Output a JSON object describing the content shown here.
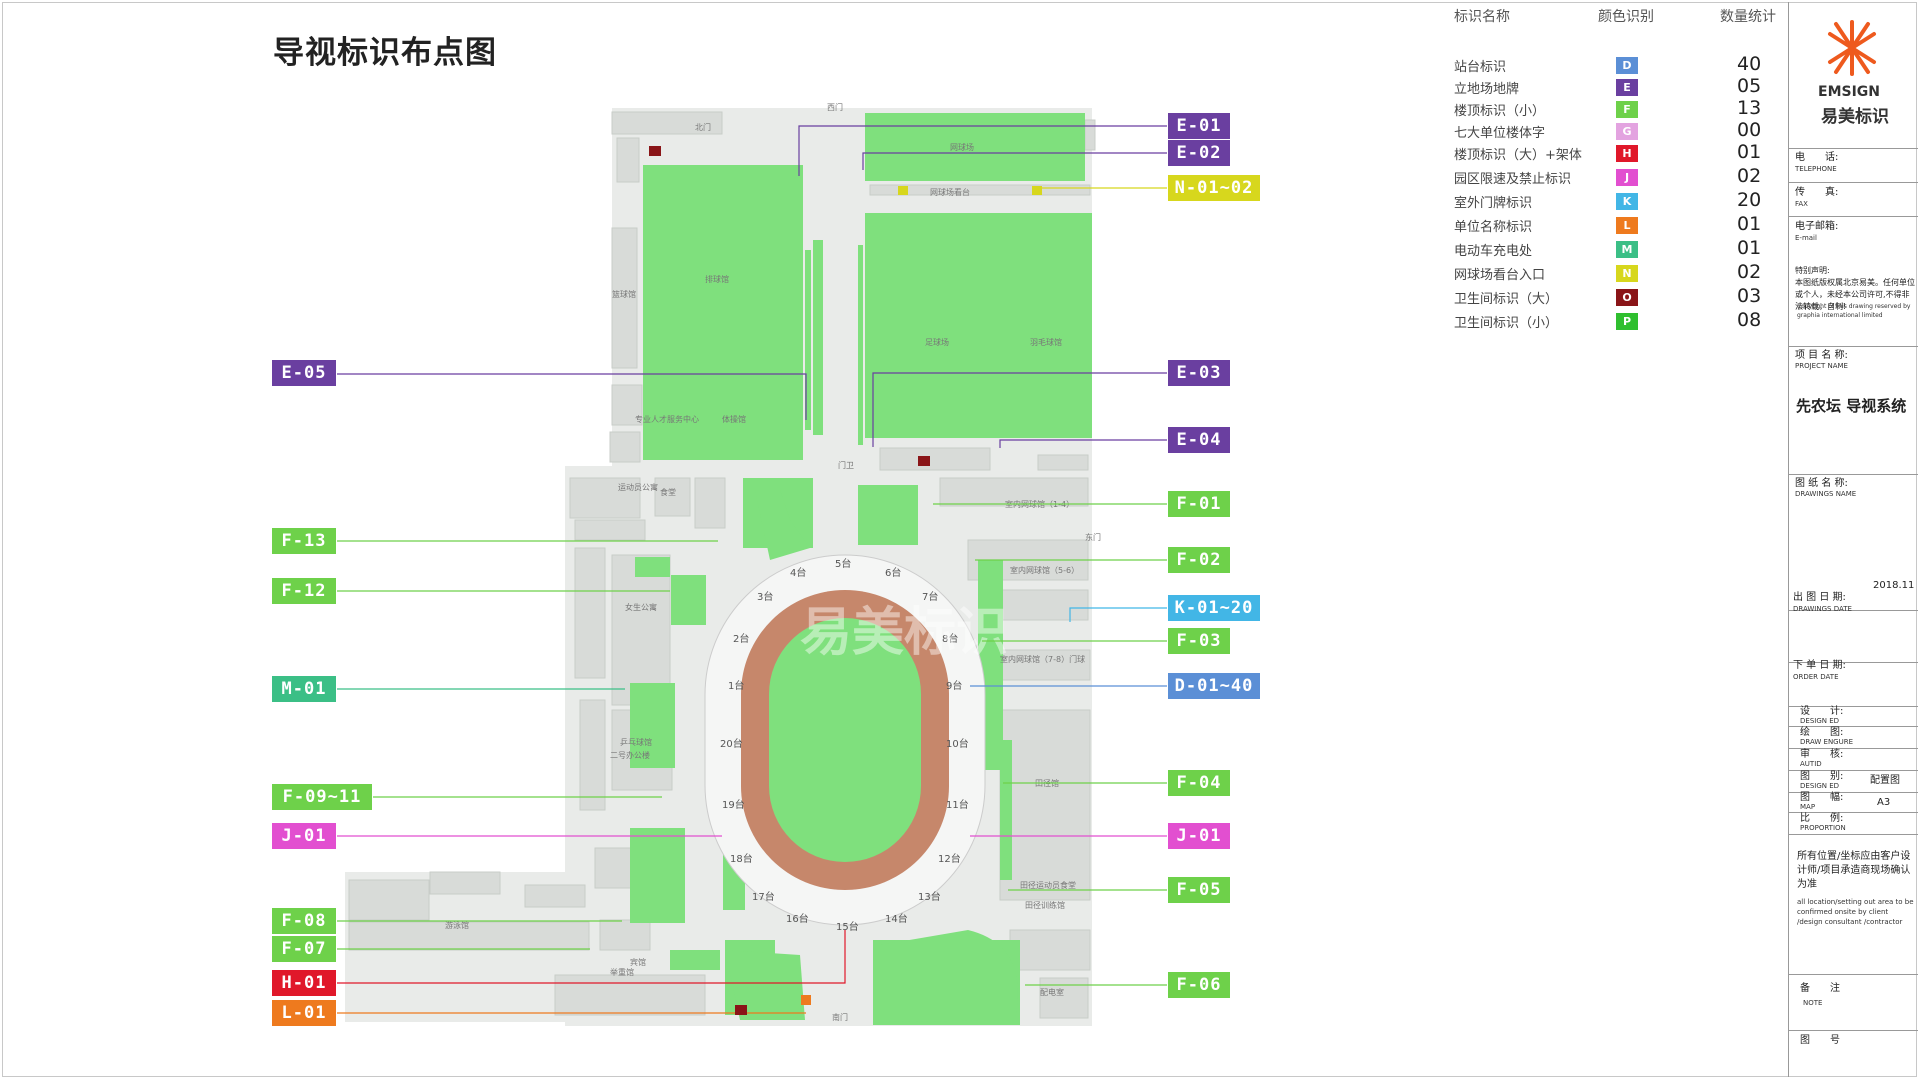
{
  "title": "导视标识布点图",
  "legend": {
    "headers": {
      "name": "标识名称",
      "color": "颜色识别",
      "count": "数量统计"
    },
    "items": [
      {
        "name": "站台标识",
        "letter": "D",
        "color": "#5b8fd6",
        "count": "40"
      },
      {
        "name": "立地场地牌",
        "letter": "E",
        "color": "#6a3fa0",
        "count": "05"
      },
      {
        "name": "楼顶标识（小）",
        "letter": "F",
        "color": "#6ed14a",
        "count": "13"
      },
      {
        "name": "七大单位楼体字",
        "letter": "G",
        "color": "#e3a3e0",
        "count": "00"
      },
      {
        "name": "楼顶标识（大）+架体",
        "letter": "H",
        "color": "#e0182a",
        "count": "01"
      },
      {
        "name": "园区限速及禁止标识",
        "letter": "J",
        "color": "#e24fd0",
        "count": "02"
      },
      {
        "name": "室外门牌标识",
        "letter": "K",
        "color": "#42b6e6",
        "count": "20"
      },
      {
        "name": "单位名称标识",
        "letter": "L",
        "color": "#ee7a1e",
        "count": "01"
      },
      {
        "name": "电动车充电处",
        "letter": "M",
        "color": "#3bbf86",
        "count": "01"
      },
      {
        "name": "网球场看台入口",
        "letter": "N",
        "color": "#d7d71d",
        "count": "02"
      },
      {
        "name": "卫生间标识（大）",
        "letter": "O",
        "color": "#8a1518",
        "count": "03"
      },
      {
        "name": "卫生间标识（小）",
        "letter": "P",
        "color": "#2fbf2f",
        "count": "08"
      }
    ]
  },
  "tags_left": [
    {
      "label": "E-05",
      "color": "#6a3fa0"
    },
    {
      "label": "F-13",
      "color": "#6ed14a"
    },
    {
      "label": "F-12",
      "color": "#6ed14a"
    },
    {
      "label": "M-01",
      "color": "#3bbf86"
    },
    {
      "label": "F-09~11",
      "color": "#6ed14a"
    },
    {
      "label": "J-01",
      "color": "#e24fd0"
    },
    {
      "label": "F-08",
      "color": "#6ed14a"
    },
    {
      "label": "F-07",
      "color": "#6ed14a"
    },
    {
      "label": "H-01",
      "color": "#e0182a"
    },
    {
      "label": "L-01",
      "color": "#ee7a1e"
    }
  ],
  "tags_right": [
    {
      "label": "E-01",
      "color": "#6a3fa0"
    },
    {
      "label": "E-02",
      "color": "#6a3fa0"
    },
    {
      "label": "N-01~02",
      "color": "#d7d71d"
    },
    {
      "label": "E-03",
      "color": "#6a3fa0"
    },
    {
      "label": "E-04",
      "color": "#6a3fa0"
    },
    {
      "label": "F-01",
      "color": "#6ed14a"
    },
    {
      "label": "F-02",
      "color": "#6ed14a"
    },
    {
      "label": "K-01~20",
      "color": "#42b6e6"
    },
    {
      "label": "F-03",
      "color": "#6ed14a"
    },
    {
      "label": "D-01~40",
      "color": "#5b8fd6"
    },
    {
      "label": "F-04",
      "color": "#6ed14a"
    },
    {
      "label": "J-01",
      "color": "#e24fd0"
    },
    {
      "label": "F-05",
      "color": "#6ed14a"
    },
    {
      "label": "F-06",
      "color": "#6ed14a"
    }
  ],
  "map_labels": [
    "西门",
    "网球场看台",
    "室内网球馆（1-4）",
    "室内网球馆（5-6）",
    "室内网球馆（7-8）门球",
    "田径馆",
    "田径运动员食堂",
    "田径训练馆",
    "东门",
    "门卫",
    "南门",
    "女生公寓",
    "二号办公楼",
    "食堂",
    "配电室",
    "运动员公寓",
    "专业人才服务中心",
    "宾馆",
    "篮球馆",
    "乒乓球馆",
    "游泳馆",
    "网球场",
    "足球场",
    "北门",
    "排球馆",
    "羽毛球馆",
    "体操馆",
    "举重馆"
  ],
  "track_labels": [
    "1台",
    "2台",
    "3台",
    "4台",
    "5台",
    "6台",
    "7台",
    "8台",
    "9台",
    "10台",
    "11台",
    "12台",
    "13台",
    "14台",
    "15台",
    "16台",
    "17台",
    "18台",
    "19台",
    "20台"
  ],
  "watermark": "易美标识",
  "title_block": {
    "logo_en": "EMSIGN",
    "logo_cn": "易美标识",
    "tel_cn": "电　　话:",
    "tel_en": "TELEPHONE",
    "fax_cn": "传　　真:",
    "fax_en": "FAX",
    "email_cn": "电子邮箱:",
    "email_en": "E-mail",
    "copyright_cn": "特别声明:\n本图纸版权属北京易美。任何单位或个人，未经本公司许可,不得非法转载，自制!",
    "copyright_en": "Copyright of this drawing reserved by graphia international limited",
    "project_name_cn": "项 目 名 称:",
    "project_name_en": "PROJECT NAME",
    "project": "先农坛 导视系统",
    "drawing_name_cn": "图 纸 名 称:",
    "drawing_name_en": "DRAWINGS NAME",
    "date_value": "2018.11",
    "draw_date_cn": "出 图 日 期:",
    "draw_date_en": "DRAWINGS DATE",
    "order_date_cn": "下 单 日 期:",
    "order_date_en": "ORDER DATE",
    "design_cn": "设　　计:",
    "design_en": "DESIGN ED",
    "drawing_cn": "绘　　图:",
    "drawing_en": "DRAW ENGURE",
    "audit_cn": "审　　核:",
    "audit_en": "AUTID",
    "category_cn": "图　　别:",
    "category_en": "DESIGN ED",
    "category_value": "配置图",
    "size_cn": "图　　幅:",
    "size_en": "MAP",
    "size_value": "A3",
    "scale_cn": "比　　例:",
    "scale_en": "PROPORTION",
    "notice_cn": "所有位置/坐标应由客户设计师/项目承造商现场确认为准",
    "notice_en": "all location/setting out area to be confirmed onsite by client /design consultant /contractor",
    "note_cn": "备　　注",
    "note_en": "NOTE",
    "drawing_no_cn": "图　　号"
  }
}
